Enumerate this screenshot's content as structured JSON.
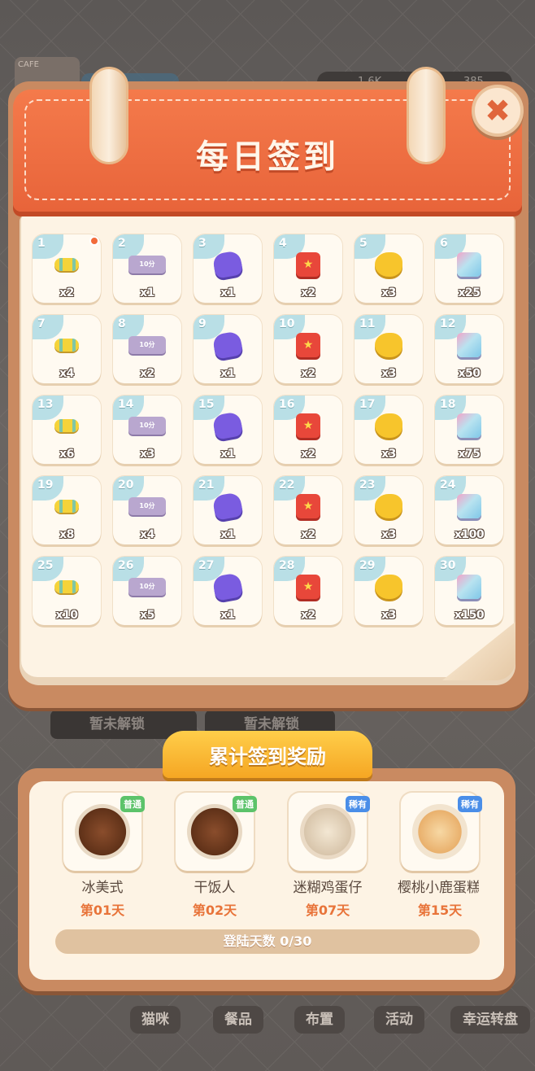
{
  "title": "每日签到",
  "close_icon": "close-icon",
  "background": {
    "cafe_sign": "CAFE",
    "resource_1": "1.6K",
    "resource_2": "385",
    "locked_1": "暂未解锁",
    "locked_2": "暂未解锁",
    "nav": [
      "猫咪",
      "餐品",
      "布置",
      "活动",
      "幸运转盘"
    ]
  },
  "days": [
    {
      "day": "1",
      "item": "candy",
      "qty": "x2"
    },
    {
      "day": "2",
      "item": "ticket",
      "qty": "x1"
    },
    {
      "day": "3",
      "item": "clover",
      "qty": "x1"
    },
    {
      "day": "4",
      "item": "coupon",
      "qty": "x2"
    },
    {
      "day": "5",
      "item": "fish",
      "qty": "x3"
    },
    {
      "day": "6",
      "item": "gem",
      "qty": "x25"
    },
    {
      "day": "7",
      "item": "candy",
      "qty": "x4"
    },
    {
      "day": "8",
      "item": "ticket",
      "qty": "x2"
    },
    {
      "day": "9",
      "item": "clover",
      "qty": "x1"
    },
    {
      "day": "10",
      "item": "coupon",
      "qty": "x2"
    },
    {
      "day": "11",
      "item": "fish",
      "qty": "x3"
    },
    {
      "day": "12",
      "item": "gem",
      "qty": "x50"
    },
    {
      "day": "13",
      "item": "candy",
      "qty": "x6"
    },
    {
      "day": "14",
      "item": "ticket",
      "qty": "x3"
    },
    {
      "day": "15",
      "item": "clover",
      "qty": "x1"
    },
    {
      "day": "16",
      "item": "coupon",
      "qty": "x2"
    },
    {
      "day": "17",
      "item": "fish",
      "qty": "x3"
    },
    {
      "day": "18",
      "item": "gem",
      "qty": "x75"
    },
    {
      "day": "19",
      "item": "candy",
      "qty": "x8"
    },
    {
      "day": "20",
      "item": "ticket",
      "qty": "x4"
    },
    {
      "day": "21",
      "item": "clover",
      "qty": "x1"
    },
    {
      "day": "22",
      "item": "coupon",
      "qty": "x2"
    },
    {
      "day": "23",
      "item": "fish",
      "qty": "x3"
    },
    {
      "day": "24",
      "item": "gem",
      "qty": "x100"
    },
    {
      "day": "25",
      "item": "candy",
      "qty": "x10"
    },
    {
      "day": "26",
      "item": "ticket",
      "qty": "x5"
    },
    {
      "day": "27",
      "item": "clover",
      "qty": "x1"
    },
    {
      "day": "28",
      "item": "coupon",
      "qty": "x2"
    },
    {
      "day": "29",
      "item": "fish",
      "qty": "x3"
    },
    {
      "day": "30",
      "item": "gem",
      "qty": "x150"
    }
  ],
  "ticket_text": "10分",
  "cumulative": {
    "title": "累计签到奖励",
    "rewards": [
      {
        "name": "冰美式",
        "day": "第01天",
        "rarity": "普通",
        "rarity_color": "#5cc36a",
        "icon": "iced-coffee"
      },
      {
        "name": "干饭人",
        "day": "第02天",
        "rarity": "普通",
        "rarity_color": "#5cc36a",
        "icon": "donut-plate"
      },
      {
        "name": "迷糊鸡蛋仔",
        "day": "第07天",
        "rarity": "稀有",
        "rarity_color": "#4a8ee8",
        "icon": "egg-puff"
      },
      {
        "name": "樱桃小鹿蛋糕",
        "day": "第15天",
        "rarity": "稀有",
        "rarity_color": "#4a8ee8",
        "icon": "deer-cake"
      }
    ],
    "progress_label": "登陆天数 0/30",
    "progress_fraction": 0
  }
}
